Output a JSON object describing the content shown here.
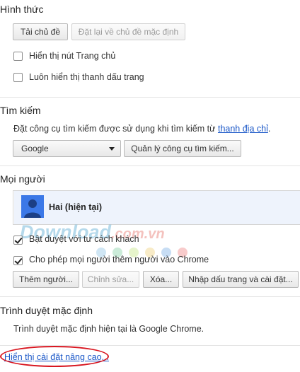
{
  "appearance": {
    "title": "Hình thức",
    "get_themes_label": "Tải chủ đề",
    "reset_theme_label": "Đặt lại về chủ đề mặc định",
    "show_home_label": "Hiển thị nút Trang chủ",
    "show_home_checked": false,
    "show_bookmarks_label": "Luôn hiển thị thanh dấu trang",
    "show_bookmarks_checked": false
  },
  "search": {
    "title": "Tìm kiếm",
    "description": "Đặt công cụ tìm kiếm được sử dụng khi tìm kiếm từ",
    "omnibox_link": "thanh địa chỉ",
    "description_end": ".",
    "engine_selected": "Google",
    "manage_label": "Quản lý công cụ tìm kiếm..."
  },
  "people": {
    "title": "Mọi người",
    "profile_name": "Hai (hiện tại)",
    "guest_label": "Bật duyệt với tư cách khách",
    "guest_checked": true,
    "allow_add_label": "Cho phép mọi người thêm người vào Chrome",
    "allow_add_checked": true,
    "add_person_label": "Thêm người...",
    "edit_label": "Chỉnh sửa...",
    "remove_label": "Xóa...",
    "import_label": "Nhập dấu trang và cài đặt..."
  },
  "default_browser": {
    "title": "Trình duyệt mặc định",
    "status": "Trình duyệt mặc định hiện tại là Google Chrome."
  },
  "footer": {
    "advanced_link": "Hiển thị cài đặt nâng cao..."
  },
  "watermark": {
    "text": "Download",
    "suffix": ".com.vn"
  },
  "colors": {
    "link": "#1a57c8",
    "avatar_bg": "#3b78e7",
    "highlight_circle": "#d8151f"
  }
}
